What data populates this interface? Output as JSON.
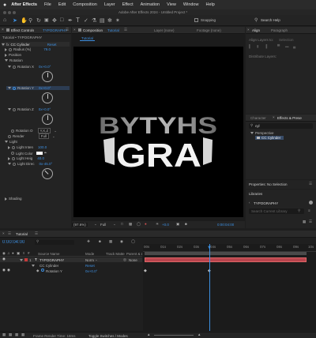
{
  "menubar": {
    "app": "After Effects",
    "items": [
      "File",
      "Edit",
      "Composition",
      "Layer",
      "Effect",
      "Animation",
      "View",
      "Window",
      "Help"
    ]
  },
  "title_bar": {
    "title": "Adobe After Effects 2024 - Untitled Project *"
  },
  "toolbar": {
    "snapping": "Snapping",
    "search_help": "Search Help"
  },
  "effect_controls": {
    "tab": "Effect Controls",
    "tab_layer": "TYPOGRAPHY",
    "path": "Tutorial • TYPOGRAPHY",
    "effect_name": "CC Cylinder",
    "reset": "Reset",
    "radius_label": "Radius (%)",
    "radius_value": "79.0",
    "position_label": "Position",
    "rotation_label": "Rotation",
    "rot_x_label": "Rotation X",
    "rot_x_value": "0x+0.0°",
    "rot_y_label": "Rotation Y",
    "rot_y_value": "0x+0.0°",
    "rot_z_label": "Rotation Z",
    "rot_z_value": "0x+0.0°",
    "rot_o_label": "Rotation O",
    "rot_o_value": "Y,X,Z",
    "render_label": "Render",
    "render_value": "Full",
    "light_label": "Light",
    "light_intens_label": "Light Inten",
    "light_intens_value": "100.0",
    "light_color_label": "Light Color",
    "light_height_label": "Light Heig",
    "light_height_value": "40.0",
    "light_dir_label": "Light Direc",
    "light_dir_value": "0x-45.0°",
    "shading_label": "Shading"
  },
  "composition": {
    "tab": "Composition",
    "tab_name": "Tutorial",
    "layer_tab": "Layer (none)",
    "footage_tab": "Footage (none)",
    "breadcrumb": "Tutorial",
    "text_top": "BYTYHS",
    "text_front": "GRA",
    "zoom": "(97.6%)",
    "resolution": "Full",
    "exposure": "+0.0",
    "timecode": "0:00:04:00"
  },
  "align_panel": {
    "tab_align": "Align",
    "tab_paragraph": "Paragraph",
    "align_layers_to": "Align Layers to:",
    "align_target": "Selection",
    "distribute": "Distribute Layers:"
  },
  "effects_presets": {
    "tab_character": "Character",
    "tab_effects": "Effects & Prese",
    "search": "cyl",
    "category": "Perspective",
    "result": "CC Cylinder"
  },
  "properties": {
    "title": "Properties: No Selection"
  },
  "libraries": {
    "title": "Libraries",
    "library": "TYPOGRAPHY",
    "search_placeholder": "Search Current Library"
  },
  "timeline": {
    "tab": "Tutorial",
    "timecode": "0:00:04:00",
    "col_source": "Source Name",
    "col_mode": "Mode",
    "col_trkmat": "Track Matte",
    "col_parent": "Parent & Link",
    "layer_num": "1",
    "layer_name": "TYPOGRAPHY",
    "layer_mode": "Norm",
    "layer_parent": "None",
    "effect_row": "CC Cylinder",
    "effect_reset": "Reset",
    "prop_row": "Rotation Y",
    "prop_value": "0x+0.0°",
    "ruler": [
      "00s",
      "01s",
      "02s",
      "03s",
      "04s",
      "05s",
      "06s",
      "07s",
      "08s",
      "09s",
      "10s"
    ],
    "footer_frame": "Frame Render Time: 18ms",
    "footer_toggle": "Toggle Switches / Modes",
    "playhead_fraction": 0.4
  }
}
